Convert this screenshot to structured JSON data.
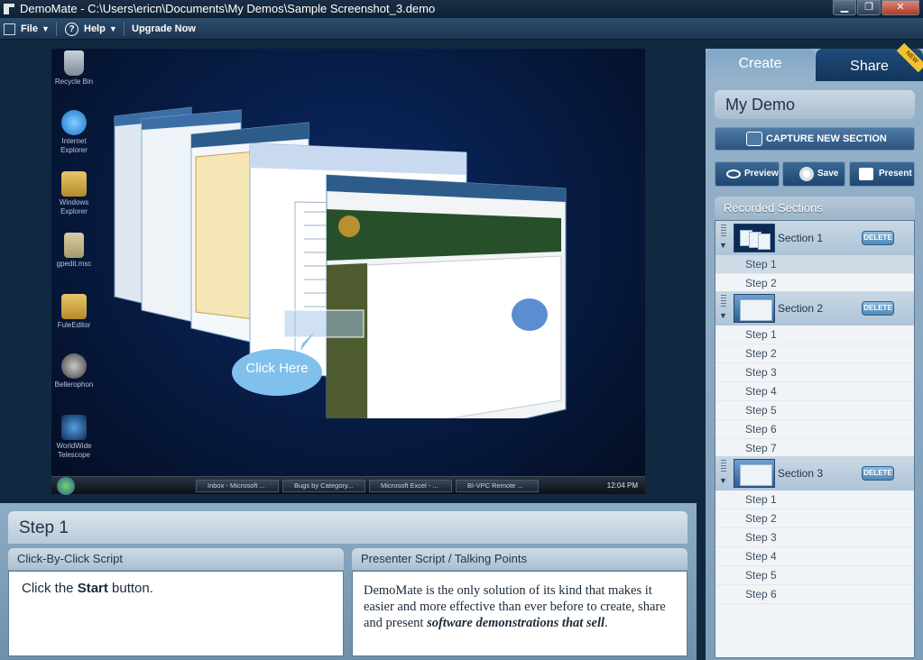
{
  "window": {
    "title": "DemoMate - C:\\Users\\ericn\\Documents\\My Demos\\Sample Screenshot_3.demo",
    "controls": [
      "▁",
      "❐",
      "✕"
    ]
  },
  "menu": {
    "file": "File",
    "help": "Help",
    "upgrade": "Upgrade Now"
  },
  "preview": {
    "desktop_icons": [
      "Recycle Bin",
      "Internet Explorer",
      "Windows Explorer",
      "gpedit.msc",
      "FuleEditor",
      "Bellerophon",
      "WorldWide Telescope"
    ],
    "callout": "Click Here",
    "taskbar": {
      "buttons": [
        "Inbox - Microsoft ...",
        "Bugs by Category...",
        "Microsoft Excel - ...",
        "BI-VPC Remote ..."
      ],
      "clock": "12:04 PM"
    }
  },
  "step": {
    "title": "Step 1",
    "click_script_header": "Click-By-Click Script",
    "click_script": {
      "prefix": "Click the ",
      "bold": "Start",
      "suffix": " button."
    },
    "presenter_header": "Presenter Script / Talking Points",
    "presenter": {
      "text": "DemoMate is the only solution of its kind that makes it easier and more effective than ever before to create, share and present ",
      "emphasis": "software demonstrations that sell",
      "end": "."
    }
  },
  "right_panel": {
    "tabs": {
      "create": "Create",
      "share": "Share",
      "new_badge": "NEW"
    },
    "demo_name": "My Demo",
    "capture_label": "CAPTURE NEW SECTION",
    "actions": {
      "preview": "Preview",
      "save": "Save",
      "present": "Present"
    },
    "recorded_header": "Recorded Sections",
    "delete_label": "DELETE",
    "sections": [
      {
        "name": "Section 1",
        "steps": [
          "Step 1",
          "Step 2"
        ]
      },
      {
        "name": "Section 2",
        "steps": [
          "Step 1",
          "Step 2",
          "Step 3",
          "Step 4",
          "Step 5",
          "Step 6",
          "Step 7"
        ]
      },
      {
        "name": "Section 3",
        "steps": [
          "Step 1",
          "Step 2",
          "Step 3",
          "Step 4",
          "Step 5",
          "Step 6"
        ]
      }
    ]
  },
  "colors": {
    "accent": "#2b557e",
    "panel": "#8eacc5",
    "badge": "#f2c230"
  }
}
